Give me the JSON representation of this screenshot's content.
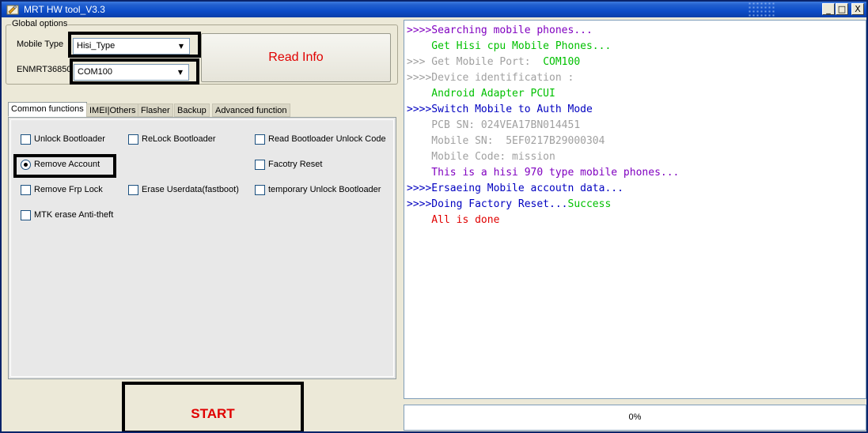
{
  "window": {
    "title": "MRT HW tool_V3.3",
    "controls": {
      "minimize": "_",
      "maximize": "□",
      "close": "X"
    }
  },
  "global_options": {
    "legend": "Global options",
    "mobile_type_label": "Mobile Type",
    "mobile_type_value": "Hisi_Type",
    "port_label": "ENMRT36850",
    "port_value": "COM100",
    "read_info_label": "Read Info"
  },
  "tabs": [
    {
      "label": "Common functions",
      "active": true
    },
    {
      "label": "IMEI|Others",
      "active": false
    },
    {
      "label": "Flasher",
      "active": false
    },
    {
      "label": "Backup",
      "active": false
    },
    {
      "label": "Advanced function",
      "active": false
    }
  ],
  "options": [
    {
      "label": "Unlock Bootloader",
      "type": "checkbox",
      "checked": false
    },
    {
      "label": "ReLock Bootloader",
      "type": "checkbox",
      "checked": false
    },
    {
      "label": "Read Bootloader Unlock Code",
      "type": "checkbox",
      "checked": false
    },
    {
      "label": "Remove Account",
      "type": "radio",
      "checked": true
    },
    {
      "label": "Facotry Reset",
      "type": "checkbox",
      "checked": false
    },
    {
      "label": "Remove Frp Lock",
      "type": "checkbox",
      "checked": false
    },
    {
      "label": "Erase Userdata(fastboot)",
      "type": "checkbox",
      "checked": false
    },
    {
      "label": "temporary Unlock Bootloader",
      "type": "checkbox",
      "checked": false
    },
    {
      "label": "MTK erase Anti-theft",
      "type": "checkbox",
      "checked": false
    }
  ],
  "start_label": "START",
  "log": [
    {
      "text": ">>>>Searching mobile phones...",
      "color": "#8000c0"
    },
    {
      "text": "    Get Hisi cpu Mobile Phones...",
      "color": "#00c000"
    },
    {
      "text": ">>> Get Mobile Port:  ",
      "color": "#a0a0a0",
      "suffix": "COM100",
      "suffix_color": "#00c000"
    },
    {
      "text": ">>>>Device identification :",
      "color": "#a0a0a0"
    },
    {
      "text": "    Android Adapter PCUI",
      "color": "#00c000"
    },
    {
      "text": ">>>>Switch Mobile to Auth Mode",
      "color": "#0000c0"
    },
    {
      "text": "    PCB SN: 024VEA17BN014451",
      "color": "#a0a0a0"
    },
    {
      "text": "    Mobile SN:  5EF0217B29000304",
      "color": "#a0a0a0"
    },
    {
      "text": "    Mobile Code: mission",
      "color": "#a0a0a0"
    },
    {
      "text": "    This is a hisi 970 type mobile phones...",
      "color": "#8000c0"
    },
    {
      "text": ">>>>Ersaeing Mobile accoutn data...",
      "color": "#0000c0"
    },
    {
      "text": ">>>>Doing Factory Reset...",
      "color": "#0000c0",
      "suffix": "Success",
      "suffix_color": "#00c000"
    },
    {
      "text": "    All is done",
      "color": "#e00000"
    }
  ],
  "progress": {
    "percent": 0,
    "label": "0%"
  },
  "colors": {
    "accent_red": "#e00000",
    "titlebar_blue": "#0c4cc8",
    "highlight_border": "#000000"
  }
}
